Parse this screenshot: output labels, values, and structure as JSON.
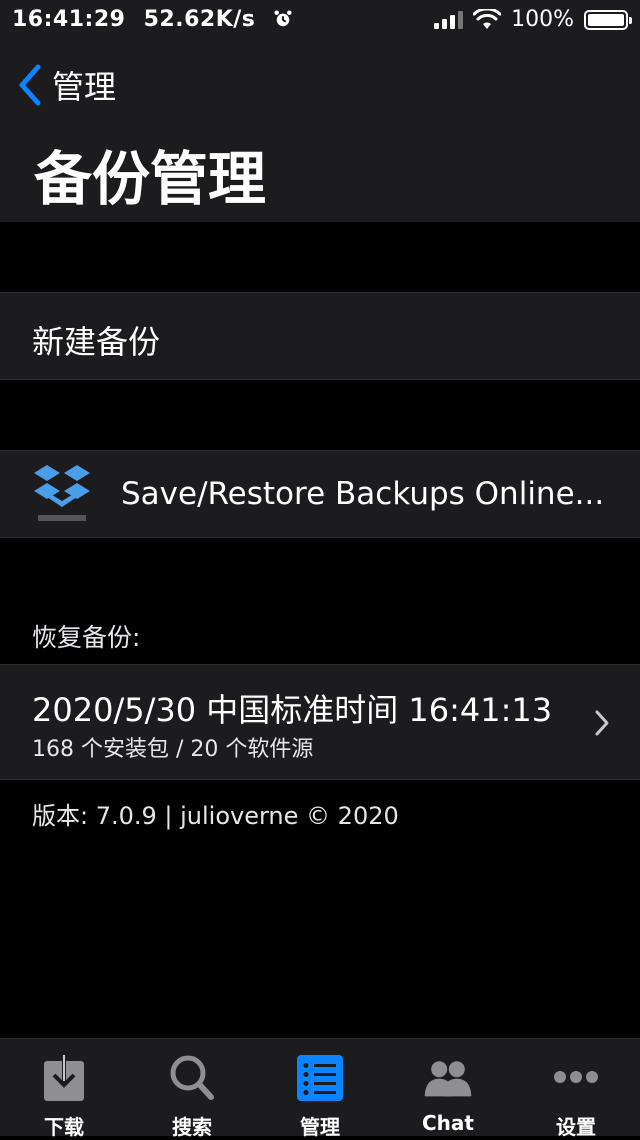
{
  "status_bar": {
    "time": "16:41:29",
    "net_speed": "52.62K/s",
    "battery": "100%",
    "battery_level": 1.0
  },
  "nav": {
    "back_label": "管理",
    "title": "备份管理"
  },
  "new_backup": {
    "label": "新建备份"
  },
  "dropbox": {
    "label": "Save/Restore Backups Online...",
    "icon": "dropbox-icon"
  },
  "restore": {
    "section_label": "恢复备份:",
    "items": [
      {
        "title": "2020/5/30 中国标准时间 16:41:13",
        "subtitle": "168 个安装包 / 20 个软件源"
      }
    ]
  },
  "footer": {
    "version_text": "版本: 7.0.9 | julioverne © 2020"
  },
  "tabbar": {
    "active_index": 2,
    "tabs": [
      {
        "label": "下载",
        "icon": "download-icon"
      },
      {
        "label": "搜索",
        "icon": "search-icon"
      },
      {
        "label": "管理",
        "icon": "manage-list-icon"
      },
      {
        "label": "Chat",
        "icon": "chat-people-icon"
      },
      {
        "label": "设置",
        "icon": "more-dots-icon"
      }
    ]
  },
  "colors": {
    "background": "#000000",
    "cell": "#1c1c1e",
    "accent": "#0a84ff"
  }
}
